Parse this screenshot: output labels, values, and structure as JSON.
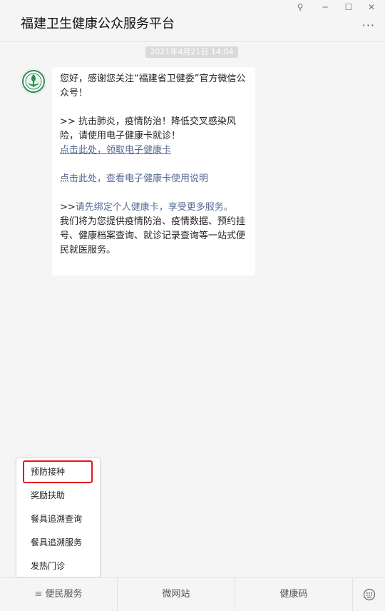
{
  "window": {
    "title": "福建卫生健康公众服务平台",
    "controls": {
      "pin": "⚲",
      "minimize": "─",
      "maximize": "☐",
      "close": "✕"
    },
    "more": "···"
  },
  "chat": {
    "timestamp": "2021年4月21日 14:04",
    "message": {
      "line1": "您好，感谢您关注“福建省卫健委”官方微信公众号！",
      "line2": ">> 抗击肺炎，疫情防治！降低交叉感染风险，请使用电子健康卡就诊！",
      "link1": "点击此处，领取电子健康卡",
      "link2": "点击此处，查看电子健康卡使用说明",
      "prefix3": ">>",
      "link3": "请先绑定个人健康卡，享受更多服务。",
      "line4": "我们将为您提供疫情防治、疫情数据、预约挂号、健康档案查询、就诊记录查询等一站式便民就医服务。"
    }
  },
  "popup_menu": {
    "items": [
      "预防接种",
      "奖励扶助",
      "餐具追溯查询",
      "餐具追溯服务",
      "发热门诊"
    ]
  },
  "bottom_menu": {
    "menu_icon": "≡",
    "items": [
      "便民服务",
      "微网站",
      "健康码"
    ]
  },
  "colors": {
    "link": "#576b95",
    "highlight": "#e8141f"
  }
}
